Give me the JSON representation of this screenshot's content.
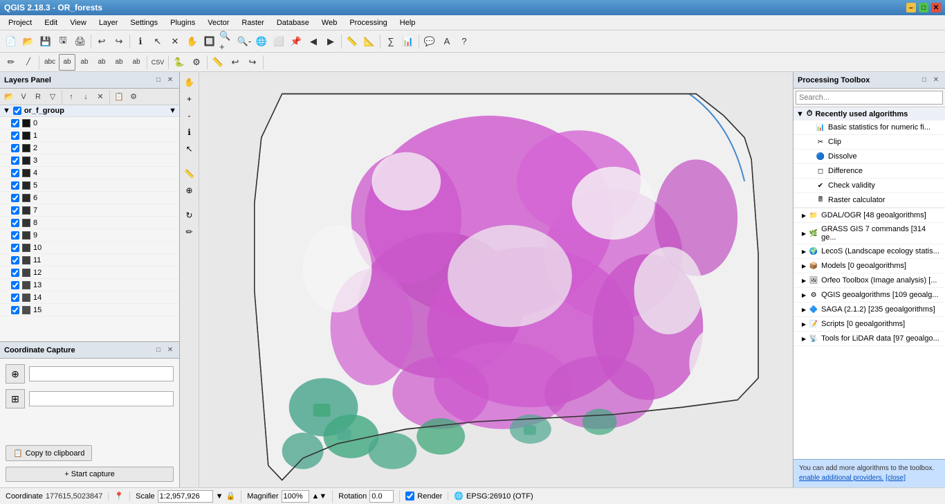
{
  "titlebar": {
    "title": "QGIS 2.18.3 - OR_forests",
    "minimize": "–",
    "maximize": "□",
    "close": "✕"
  },
  "menubar": {
    "items": [
      "Project",
      "Edit",
      "View",
      "Layer",
      "Settings",
      "Plugins",
      "Vector",
      "Raster",
      "Database",
      "Web",
      "Processing",
      "Help"
    ]
  },
  "toolbar1": {
    "buttons": [
      "📂",
      "💾",
      "🖨",
      "✂",
      "📋",
      "🔁",
      "🔍",
      "➕",
      "➖",
      "🔲",
      "✋",
      "👆",
      "🔍",
      "◀",
      "▶",
      "📌",
      "🗺",
      "📏",
      "📐",
      "🌐",
      "ℹ",
      "📊",
      "∑",
      "…",
      "💬",
      "A",
      "?"
    ]
  },
  "toolbar2": {
    "buttons": [
      "✏",
      "╱",
      "□",
      "⭕",
      "✚",
      "✕",
      "◻",
      "⬚",
      "☐",
      "Abc",
      "ab",
      "AB",
      "ab",
      "ab",
      "ab",
      "ab",
      "CSV",
      "🐍",
      "⚙",
      "◻",
      "📏",
      "↩",
      "↪",
      "🔄",
      "↗",
      "↘",
      "👁",
      "🔑",
      "⚓",
      "🔗",
      "⇄",
      "↕",
      "➡"
    ]
  },
  "layers_panel": {
    "title": "Layers Panel",
    "layer_group": "or_f_group",
    "layers": [
      {
        "id": 0,
        "label": "0",
        "color": "#111111"
      },
      {
        "id": 1,
        "label": "1",
        "color": "#151515"
      },
      {
        "id": 2,
        "label": "2",
        "color": "#1a1a1a"
      },
      {
        "id": 3,
        "label": "3",
        "color": "#1e1e1e"
      },
      {
        "id": 4,
        "label": "4",
        "color": "#222222"
      },
      {
        "id": 5,
        "label": "5",
        "color": "#262626"
      },
      {
        "id": 6,
        "label": "6",
        "color": "#2a2a2a"
      },
      {
        "id": 7,
        "label": "7",
        "color": "#2e2e2e"
      },
      {
        "id": 8,
        "label": "8",
        "color": "#333333"
      },
      {
        "id": 9,
        "label": "9",
        "color": "#363636"
      },
      {
        "id": 10,
        "label": "10",
        "color": "#3a3a3a"
      },
      {
        "id": 11,
        "label": "11",
        "color": "#3e3e3e"
      },
      {
        "id": 12,
        "label": "12",
        "color": "#424242"
      },
      {
        "id": 13,
        "label": "13",
        "color": "#464646"
      },
      {
        "id": 14,
        "label": "14",
        "color": "#4a4a4a"
      },
      {
        "id": 15,
        "label": "15",
        "color": "#4e4e4e"
      }
    ]
  },
  "coordinate_capture": {
    "title": "Coordinate Capture",
    "copy_label": "Copy to clipboard",
    "capture_label": "+ Start capture",
    "coord1_placeholder": "",
    "coord2_placeholder": ""
  },
  "processing_toolbox": {
    "title": "Processing Toolbox",
    "search_placeholder": "Search...",
    "recently_used_label": "Recently used algorithms",
    "recently_used_items": [
      {
        "label": "Basic statistics for numeric fi...",
        "icon": "📊"
      },
      {
        "label": "Clip",
        "icon": "✂"
      },
      {
        "label": "Dissolve",
        "icon": "🔵"
      },
      {
        "label": "Difference",
        "icon": "◻"
      },
      {
        "label": "Check validity",
        "icon": "✔"
      },
      {
        "label": "Raster calculator",
        "icon": "🖩"
      }
    ],
    "toolbox_items": [
      {
        "label": "GDAL/OGR [48 geoalgorithms]",
        "icon": "📁"
      },
      {
        "label": "GRASS GIS 7 commands [314 ge...",
        "icon": "🌿"
      },
      {
        "label": "LecoS (Landscape ecology statis...",
        "icon": "🌍"
      },
      {
        "label": "Models [0 geoalgorithms]",
        "icon": "📦"
      },
      {
        "label": "Orfeo Toolbox (Image analysis) [...",
        "icon": "🖼"
      },
      {
        "label": "QGIS geoalgorithms [109 geoalg...",
        "icon": "⚙"
      },
      {
        "label": "SAGA (2.1.2) [235 geoalgorithms]",
        "icon": "🔷"
      },
      {
        "label": "Scripts [0 geoalgorithms]",
        "icon": "📝"
      },
      {
        "label": "Tools for LiDAR data [97 geoalgo...",
        "icon": "📡"
      }
    ],
    "info_text": "You can add more algorithms to the toolbox.",
    "info_link": "enable additional providers.",
    "info_close": "[close]"
  },
  "statusbar": {
    "coordinate_label": "Coordinate",
    "coordinate_value": "177615,5023847",
    "scale_label": "Scale",
    "scale_value": "1:2,957,926",
    "magnifier_label": "Magnifier",
    "magnifier_value": "100%",
    "rotation_label": "Rotation",
    "rotation_value": "0.0",
    "render_label": "Render",
    "epsg_label": "EPSG:26910 (OTF)"
  },
  "icons": {
    "expand": "▶",
    "collapse": "▼",
    "close": "✕",
    "restore": "□",
    "settings": "⚙",
    "search": "🔍",
    "capture": "⊕",
    "grid": "⊞"
  }
}
